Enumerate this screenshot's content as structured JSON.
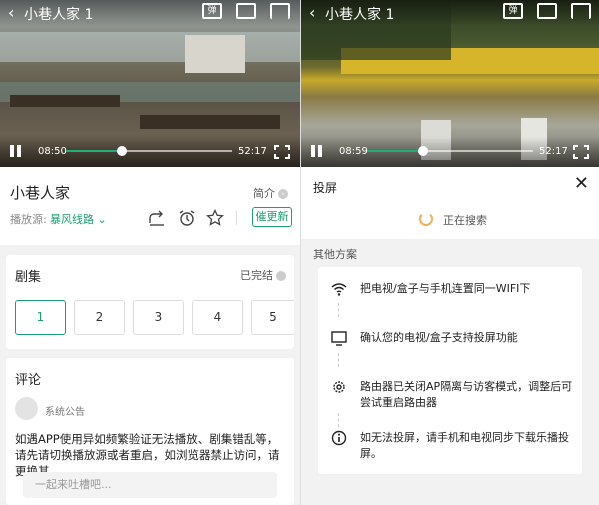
{
  "left_player": {
    "title": "小巷人家 1",
    "danmu_label": "弹",
    "current_time": "08:50",
    "duration": "52:17",
    "progress": 0.34
  },
  "right_player": {
    "title": "小巷人家 1",
    "danmu_label": "弹",
    "current_time": "08:59",
    "duration": "52:17",
    "progress": 0.34
  },
  "show": {
    "title": "小巷人家",
    "intro_label": "简介",
    "source_label": "播放源:",
    "source_value": "暴风线路",
    "urge_label": "催更新"
  },
  "episodes": {
    "section_title": "剧集",
    "status": "已完结",
    "items": [
      "1",
      "2",
      "3",
      "4",
      "5"
    ],
    "active_index": 0
  },
  "comments": {
    "section_title": "评论",
    "user": "系统公告",
    "text": "如遇APP使用异如频繁验证无法播放、剧集错乱等，请先请切换播放源或者重启，如浏览器禁止访问，请更换其",
    "input_placeholder": "一起来吐槽吧..."
  },
  "cast": {
    "title": "投屏",
    "searching": "正在搜索",
    "other_label": "其他方案",
    "steps": [
      {
        "icon": "wifi-icon",
        "text": "把电视/盒子与手机连置同一WIFI下"
      },
      {
        "icon": "tv-icon",
        "text": "确认您的电视/盒子支持投屏功能"
      },
      {
        "icon": "gear-icon",
        "text": "路由器已关闭AP隔离与访客模式，调整后可尝试重启路由器"
      },
      {
        "icon": "info-icon",
        "text": "如无法投屏，请手机和电视同步下载乐播投屏。"
      }
    ]
  },
  "colors": {
    "accent": "#1a9d6f",
    "spinner": "#f0b15a"
  }
}
